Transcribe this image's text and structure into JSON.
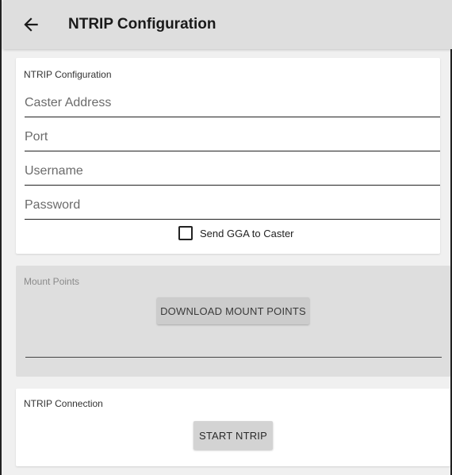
{
  "appbar": {
    "title": "NTRIP Configuration",
    "back_icon": "arrow-left-icon"
  },
  "config": {
    "section_label": "NTRIP Configuration",
    "fields": {
      "caster_address": {
        "placeholder": "Caster Address",
        "value": ""
      },
      "port": {
        "placeholder": "Port",
        "value": ""
      },
      "username": {
        "placeholder": "Username",
        "value": ""
      },
      "password": {
        "placeholder": "Password",
        "value": ""
      }
    },
    "send_gga": {
      "label": "Send GGA to Caster",
      "checked": false
    }
  },
  "mount": {
    "section_label": "Mount Points",
    "button_label": "DOWNLOAD MOUNT POINTS",
    "selected_value": ""
  },
  "connection": {
    "section_label": "NTRIP Connection",
    "button_label": "START NTRIP"
  },
  "colors": {
    "appbar_bg": "#dedede",
    "page_bg": "#f0f0f0",
    "button_bg": "#d3d3d3"
  }
}
